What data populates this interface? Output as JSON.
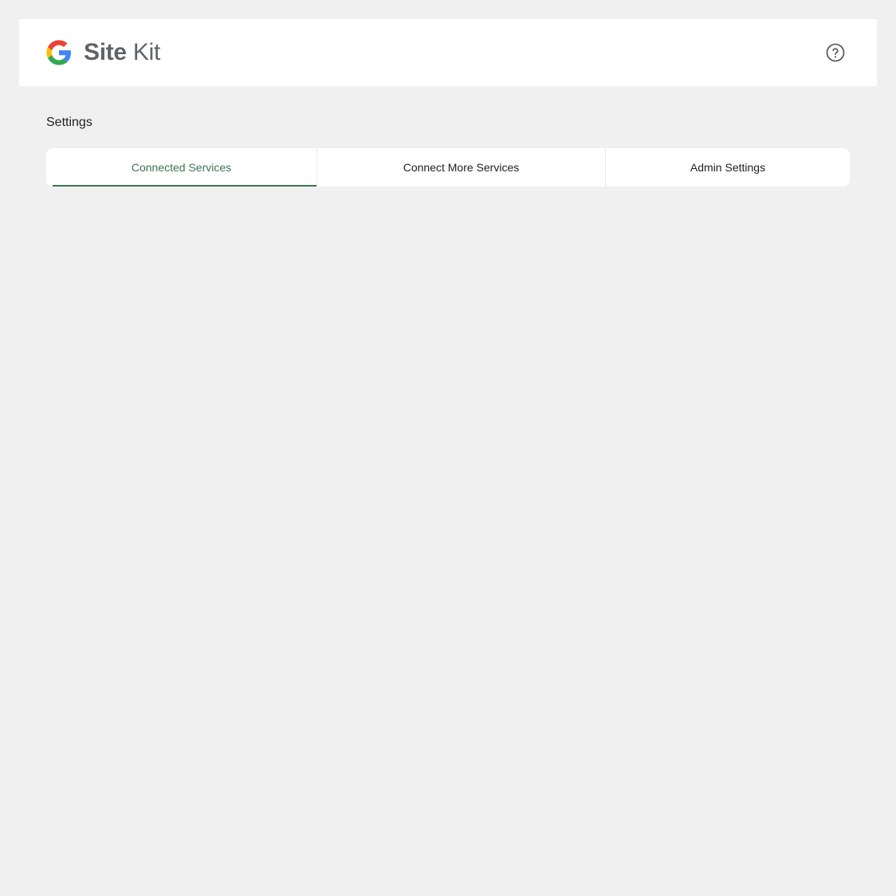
{
  "header": {
    "logo_icon": "google-g-icon",
    "brand_bold": "Site",
    "brand_light": "Kit",
    "help_icon": "help-circle-icon"
  },
  "page": {
    "title": "Settings"
  },
  "tabs": [
    {
      "label": "Connected Services",
      "active": true
    },
    {
      "label": "Connect More Services",
      "active": false
    },
    {
      "label": "Admin Settings",
      "active": false
    }
  ],
  "colors": {
    "background": "#f0f0f0",
    "surface": "#ffffff",
    "accent": "#3c7251",
    "text": "#202124",
    "logo_text": "#5f6368"
  }
}
